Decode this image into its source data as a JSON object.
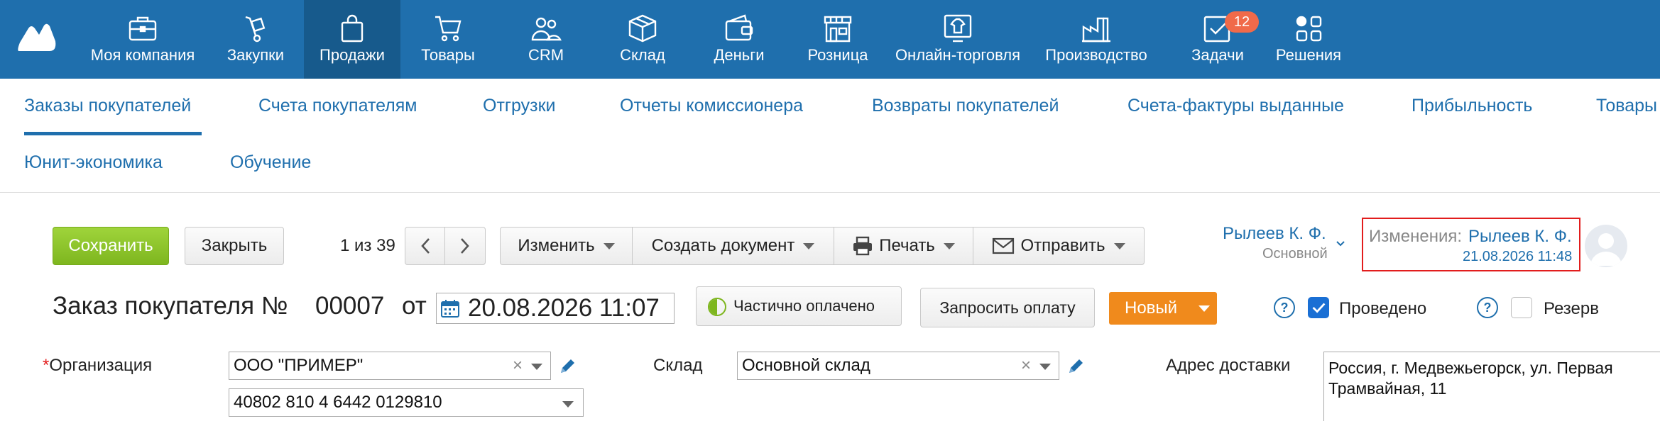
{
  "topnav": {
    "items": [
      {
        "label": "Моя компания",
        "icon": "briefcase-icon"
      },
      {
        "label": "Закупки",
        "icon": "hand-truck-icon"
      },
      {
        "label": "Продажи",
        "icon": "shopping-bag-icon",
        "active": true
      },
      {
        "label": "Товары",
        "icon": "cart-icon"
      },
      {
        "label": "CRM",
        "icon": "people-icon"
      },
      {
        "label": "Склад",
        "icon": "box-icon"
      },
      {
        "label": "Деньги",
        "icon": "wallet-icon"
      },
      {
        "label": "Розница",
        "icon": "store-icon"
      },
      {
        "label": "Онлайн-торговля",
        "icon": "online-shop-icon"
      },
      {
        "label": "Производство",
        "icon": "factory-icon"
      },
      {
        "label": "Задачи",
        "icon": "task-check-icon",
        "badge": "12"
      },
      {
        "label": "Решения",
        "icon": "apps-grid-icon"
      }
    ],
    "colors": {
      "background": "#1f6fad",
      "active": "#175a8c",
      "badge": "#f06a4a"
    }
  },
  "subnav": {
    "items": [
      "Заказы покупателей",
      "Счета покупателям",
      "Отгрузки",
      "Отчеты комиссионера",
      "Возвраты покупателей",
      "Счета-фактуры выданные",
      "Прибыльность",
      "Товары",
      "Юнит-экономика",
      "Обучение"
    ]
  },
  "toolbar": {
    "save": "Сохранить",
    "close": "Закрыть",
    "pager": "1 из 39",
    "change": "Изменить",
    "create_doc": "Создать документ",
    "print": "Печать",
    "send": "Отправить"
  },
  "user": {
    "name": "Рылеев К. Ф.",
    "role": "Основной"
  },
  "changes": {
    "label": "Изменения:",
    "user": "Рылеев К. Ф.",
    "date": "21.08.2026 11:48"
  },
  "order": {
    "title": "Заказ покупателя №",
    "number": "00007",
    "from": "от",
    "date": "20.08.2026 11:07",
    "payment_status": "Частично оплачено",
    "request_payment": "Запросить оплату",
    "status": "Новый",
    "posted_label": "Проведено",
    "posted": true,
    "reserve_label": "Резерв",
    "reserve": false,
    "help": "?"
  },
  "form": {
    "org_star": "*",
    "org_label": "Организация",
    "org_value": "ООО \"ПРИМЕР\"",
    "account_value": "40802 810 4 6442 0129810",
    "warehouse_label": "Склад",
    "warehouse_value": "Основной склад",
    "address_label": "Адрес доставки",
    "address_value": "Россия, г. Медвежьегорск, ул. Первая Трамвайная, 11",
    "clear": "×"
  },
  "colors": {
    "accent": "#1f6fad",
    "save": "#8cc62a",
    "new_status": "#f08a1c",
    "highlight_border": "#e21d1d"
  }
}
